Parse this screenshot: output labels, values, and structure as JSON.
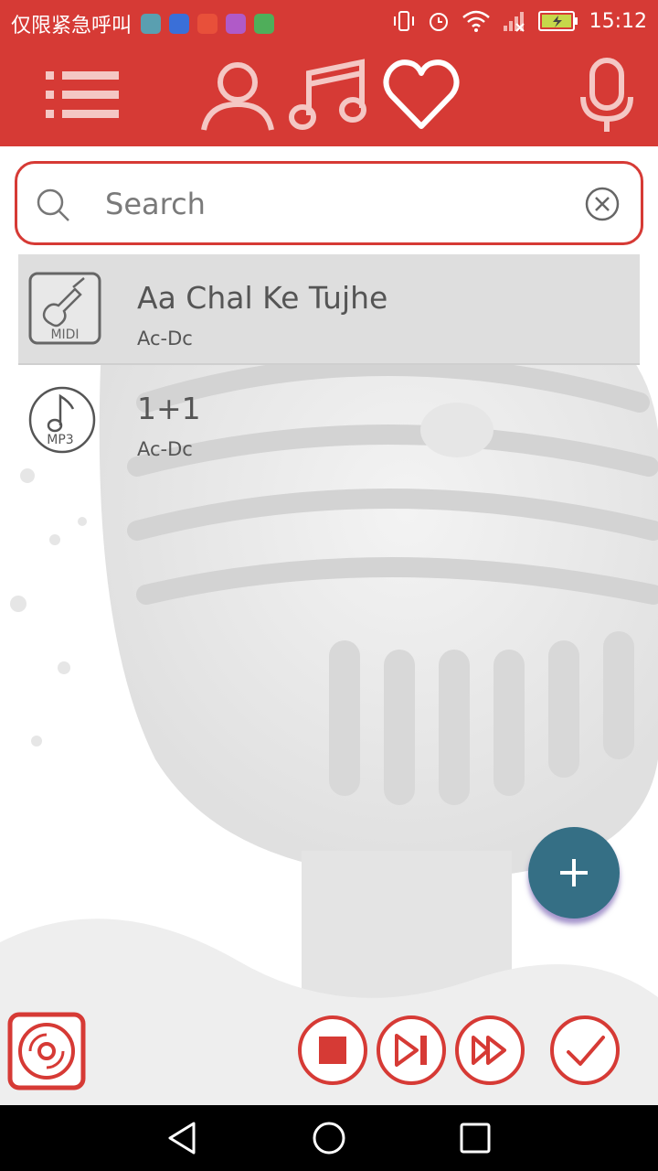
{
  "status_bar": {
    "carrier_text": "仅限紧急呼叫",
    "time": "15:12",
    "notification_icons": [
      "gallery-app-icon",
      "tieba-app-icon",
      "video-app-icon",
      "photo-app-icon",
      "grid-app-icon"
    ],
    "indicators": [
      "vibrate-icon",
      "alarm-icon",
      "wifi-icon",
      "signal-icon",
      "battery-charging-icon"
    ]
  },
  "toolbar": {
    "icons": [
      "menu-list-icon",
      "artist-person-icon",
      "music-note-icon",
      "favorite-heart-icon",
      "microphone-icon"
    ]
  },
  "search": {
    "placeholder": "Search",
    "value": ""
  },
  "songs": [
    {
      "title": "Aa Chal Ke Tujhe",
      "artist": "Ac-Dc",
      "format_label": "MIDI",
      "selected": true
    },
    {
      "title": "1+1",
      "artist": "Ac-Dc",
      "format_label": "MP3",
      "selected": false
    }
  ],
  "controls": [
    "record-disc-icon",
    "stop-icon",
    "skip-next-icon",
    "fast-forward-icon",
    "check-icon"
  ],
  "fab": {
    "icon": "plus-icon"
  },
  "colors": {
    "accent": "#d63a35",
    "fab": "#356f85",
    "text": "#555555"
  }
}
